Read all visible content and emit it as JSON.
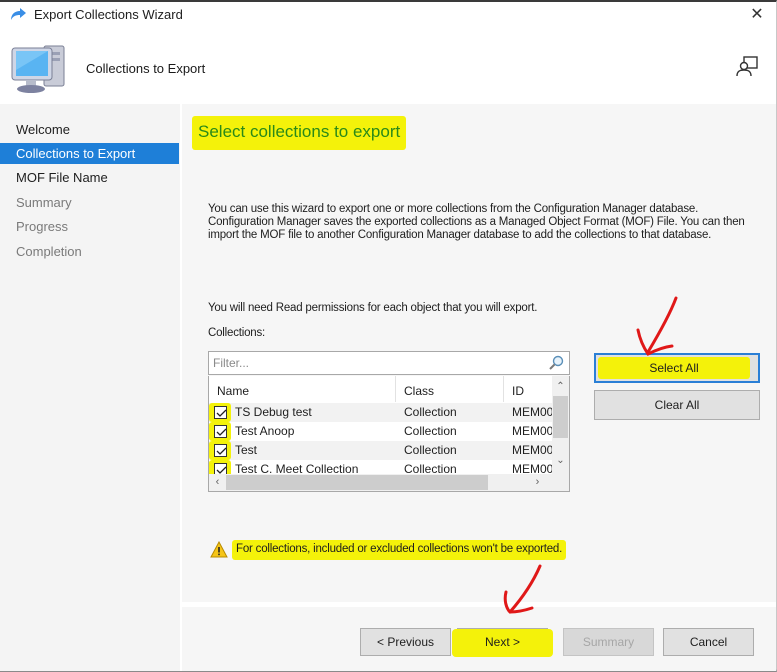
{
  "window": {
    "title": "Export Collections Wizard",
    "close_label": "✕",
    "header_subtitle": "Collections to Export"
  },
  "sidebar": {
    "items": [
      {
        "label": "Welcome",
        "state": "completed"
      },
      {
        "label": "Collections to Export",
        "state": "active"
      },
      {
        "label": "MOF File Name",
        "state": "enabled"
      },
      {
        "label": "Summary",
        "state": "disabled"
      },
      {
        "label": "Progress",
        "state": "disabled"
      },
      {
        "label": "Completion",
        "state": "disabled"
      }
    ]
  },
  "content": {
    "page_title": "Select collections to export",
    "description": "You can use this wizard to export one or more collections from the Configuration Manager database. Configuration Manager saves the exported collections as a Managed Object Format (MOF) File. You can then import the MOF file to another Configuration Manager database to add the collections to that database.",
    "permission_note": "You will need Read permissions for each object that you will export.",
    "collections_label": "Collections:",
    "filter": {
      "value": "",
      "placeholder": "Filter..."
    },
    "table": {
      "columns": [
        "Name",
        "Class",
        "ID"
      ],
      "rows": [
        {
          "name": "TS Debug test",
          "class": "Collection",
          "id": "MEM00",
          "checked": true
        },
        {
          "name": "Test Anoop",
          "class": "Collection",
          "id": "MEM00",
          "checked": true
        },
        {
          "name": "Test",
          "class": "Collection",
          "id": "MEM00",
          "checked": true
        },
        {
          "name": "Test C. Meet Collection",
          "class": "Collection",
          "id": "MEM00",
          "checked": true
        }
      ]
    },
    "select_all_label": "Select All",
    "clear_all_label": "Clear All",
    "warning": "For collections, included or excluded collections won't be exported."
  },
  "footer": {
    "previous_label": "< Previous",
    "next_label": "Next >",
    "summary_label": "Summary",
    "cancel_label": "Cancel"
  },
  "colors": {
    "accent": "#1e7fd8",
    "highlight": "#f4f20a",
    "title_green": "#2a8a18",
    "annotation_red": "#e01818"
  }
}
